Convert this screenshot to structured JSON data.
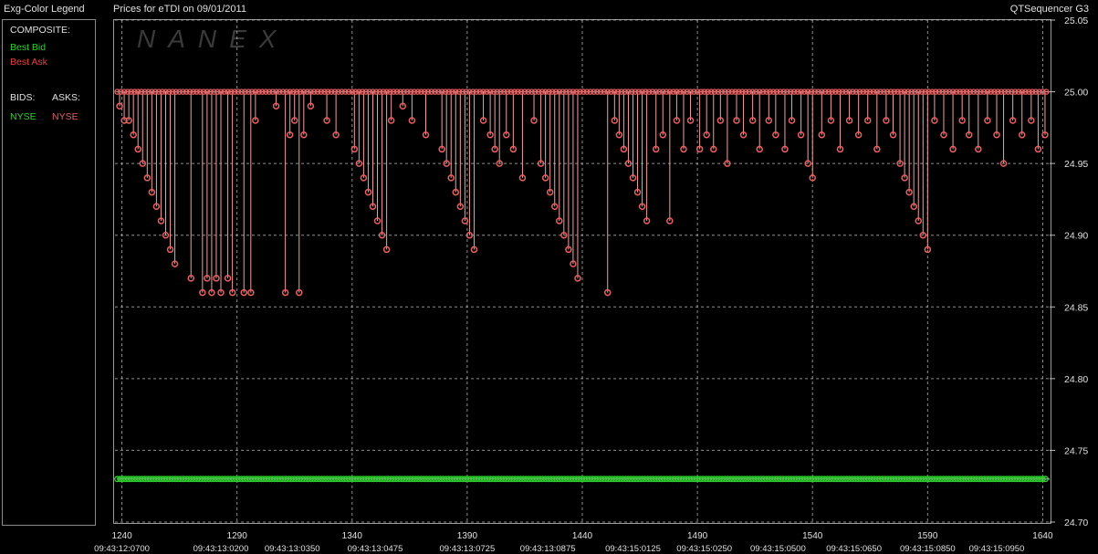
{
  "header": {
    "legend_title": "Exg-Color Legend",
    "chart_title": "Prices for  eTDI  on  09/01/2011",
    "app_name": "QTSequencer G3"
  },
  "legend": {
    "composite_label": "COMPOSITE:",
    "best_bid": "Best Bid",
    "best_ask": "Best Ask",
    "bids_label": "BIDS:",
    "asks_label": "ASKS:",
    "bid_exchange": "NYSE",
    "ask_exchange": "NYSE"
  },
  "watermark": "NANEX",
  "colors": {
    "bid": "#2ed12e",
    "ask": "#e86060",
    "ask_line": "#f0a0a0",
    "background": "#000000",
    "grid": "#bdbdbd"
  },
  "chart_data": {
    "type": "line",
    "title": "Prices for  eTDI  on  09/01/2011",
    "xlabel": "",
    "ylabel": "",
    "xlim": [
      1237,
      1643
    ],
    "ylim": [
      24.7,
      25.05
    ],
    "grid": true,
    "y_ticks": [
      "25.05",
      "25.00",
      "24.95",
      "24.90",
      "24.85",
      "24.80",
      "24.75",
      "24.70"
    ],
    "x_ticks": [
      1240,
      1290,
      1340,
      1390,
      1440,
      1490,
      1540,
      1590,
      1640
    ],
    "time_labels": [
      {
        "seq": 1240,
        "label": "09:43:12:0700"
      },
      {
        "seq": 1283,
        "label": "09:43:13:0200"
      },
      {
        "seq": 1314,
        "label": "09:43:13:0350"
      },
      {
        "seq": 1350,
        "label": "09:43:13:0475"
      },
      {
        "seq": 1390,
        "label": "09:43:13:0725"
      },
      {
        "seq": 1425,
        "label": "09:43:13:0875"
      },
      {
        "seq": 1462,
        "label": "09:43:15:0125"
      },
      {
        "seq": 1493,
        "label": "09:43:15:0250"
      },
      {
        "seq": 1525,
        "label": "09:43:15:0500"
      },
      {
        "seq": 1558,
        "label": "09:43:15:0650"
      },
      {
        "seq": 1590,
        "label": "09:43:15:0850"
      },
      {
        "seq": 1620,
        "label": "09:43:15:0950"
      }
    ],
    "series": [
      {
        "name": "NYSE Bid",
        "y": 24.73,
        "x_start": 1238,
        "x_end": 1642
      },
      {
        "name": "NYSE Ask",
        "y_level": 25.0,
        "dips": [
          {
            "x": 1239,
            "y": 24.99
          },
          {
            "x": 1241,
            "y": 24.98
          },
          {
            "x": 1243,
            "y": 24.98
          },
          {
            "x": 1245,
            "y": 24.97
          },
          {
            "x": 1247,
            "y": 24.96
          },
          {
            "x": 1249,
            "y": 24.95
          },
          {
            "x": 1251,
            "y": 24.94
          },
          {
            "x": 1253,
            "y": 24.93
          },
          {
            "x": 1255,
            "y": 24.92
          },
          {
            "x": 1257,
            "y": 24.91
          },
          {
            "x": 1259,
            "y": 24.9
          },
          {
            "x": 1261,
            "y": 24.89
          },
          {
            "x": 1263,
            "y": 24.88
          },
          {
            "x": 1270,
            "y": 24.87
          },
          {
            "x": 1275,
            "y": 24.86
          },
          {
            "x": 1277,
            "y": 24.87
          },
          {
            "x": 1279,
            "y": 24.86
          },
          {
            "x": 1281,
            "y": 24.87
          },
          {
            "x": 1283,
            "y": 24.86
          },
          {
            "x": 1286,
            "y": 24.87
          },
          {
            "x": 1288,
            "y": 24.86
          },
          {
            "x": 1293,
            "y": 24.86
          },
          {
            "x": 1296,
            "y": 24.86
          },
          {
            "x": 1298,
            "y": 24.98
          },
          {
            "x": 1307,
            "y": 24.99
          },
          {
            "x": 1311,
            "y": 24.86
          },
          {
            "x": 1313,
            "y": 24.97
          },
          {
            "x": 1315,
            "y": 24.98
          },
          {
            "x": 1317,
            "y": 24.86
          },
          {
            "x": 1319,
            "y": 24.97
          },
          {
            "x": 1322,
            "y": 24.99
          },
          {
            "x": 1329,
            "y": 24.98
          },
          {
            "x": 1333,
            "y": 24.97
          },
          {
            "x": 1341,
            "y": 24.96
          },
          {
            "x": 1343,
            "y": 24.95
          },
          {
            "x": 1345,
            "y": 24.94
          },
          {
            "x": 1347,
            "y": 24.93
          },
          {
            "x": 1349,
            "y": 24.92
          },
          {
            "x": 1351,
            "y": 24.91
          },
          {
            "x": 1353,
            "y": 24.9
          },
          {
            "x": 1355,
            "y": 24.89
          },
          {
            "x": 1357,
            "y": 24.98
          },
          {
            "x": 1362,
            "y": 24.99
          },
          {
            "x": 1366,
            "y": 24.98
          },
          {
            "x": 1372,
            "y": 24.97
          },
          {
            "x": 1379,
            "y": 24.96
          },
          {
            "x": 1381,
            "y": 24.95
          },
          {
            "x": 1383,
            "y": 24.94
          },
          {
            "x": 1385,
            "y": 24.93
          },
          {
            "x": 1387,
            "y": 24.92
          },
          {
            "x": 1389,
            "y": 24.91
          },
          {
            "x": 1391,
            "y": 24.9
          },
          {
            "x": 1393,
            "y": 24.89
          },
          {
            "x": 1397,
            "y": 24.98
          },
          {
            "x": 1400,
            "y": 24.97
          },
          {
            "x": 1402,
            "y": 24.96
          },
          {
            "x": 1404,
            "y": 24.95
          },
          {
            "x": 1407,
            "y": 24.97
          },
          {
            "x": 1410,
            "y": 24.96
          },
          {
            "x": 1414,
            "y": 24.94
          },
          {
            "x": 1419,
            "y": 24.98
          },
          {
            "x": 1422,
            "y": 24.95
          },
          {
            "x": 1424,
            "y": 24.94
          },
          {
            "x": 1426,
            "y": 24.93
          },
          {
            "x": 1428,
            "y": 24.92
          },
          {
            "x": 1430,
            "y": 24.91
          },
          {
            "x": 1432,
            "y": 24.9
          },
          {
            "x": 1434,
            "y": 24.89
          },
          {
            "x": 1436,
            "y": 24.88
          },
          {
            "x": 1438,
            "y": 24.87
          },
          {
            "x": 1451,
            "y": 24.86
          },
          {
            "x": 1454,
            "y": 24.98
          },
          {
            "x": 1456,
            "y": 24.97
          },
          {
            "x": 1458,
            "y": 24.96
          },
          {
            "x": 1460,
            "y": 24.95
          },
          {
            "x": 1462,
            "y": 24.94
          },
          {
            "x": 1464,
            "y": 24.93
          },
          {
            "x": 1466,
            "y": 24.92
          },
          {
            "x": 1468,
            "y": 24.91
          },
          {
            "x": 1472,
            "y": 24.96
          },
          {
            "x": 1475,
            "y": 24.97
          },
          {
            "x": 1478,
            "y": 24.91
          },
          {
            "x": 1481,
            "y": 24.98
          },
          {
            "x": 1484,
            "y": 24.96
          },
          {
            "x": 1487,
            "y": 24.98
          },
          {
            "x": 1491,
            "y": 24.96
          },
          {
            "x": 1494,
            "y": 24.97
          },
          {
            "x": 1497,
            "y": 24.96
          },
          {
            "x": 1500,
            "y": 24.98
          },
          {
            "x": 1503,
            "y": 24.95
          },
          {
            "x": 1507,
            "y": 24.98
          },
          {
            "x": 1510,
            "y": 24.97
          },
          {
            "x": 1514,
            "y": 24.98
          },
          {
            "x": 1517,
            "y": 24.96
          },
          {
            "x": 1521,
            "y": 24.98
          },
          {
            "x": 1524,
            "y": 24.97
          },
          {
            "x": 1528,
            "y": 24.96
          },
          {
            "x": 1531,
            "y": 24.98
          },
          {
            "x": 1535,
            "y": 24.97
          },
          {
            "x": 1538,
            "y": 24.95
          },
          {
            "x": 1540,
            "y": 24.94
          },
          {
            "x": 1544,
            "y": 24.97
          },
          {
            "x": 1548,
            "y": 24.98
          },
          {
            "x": 1552,
            "y": 24.96
          },
          {
            "x": 1556,
            "y": 24.98
          },
          {
            "x": 1560,
            "y": 24.97
          },
          {
            "x": 1564,
            "y": 24.98
          },
          {
            "x": 1568,
            "y": 24.96
          },
          {
            "x": 1572,
            "y": 24.98
          },
          {
            "x": 1575,
            "y": 24.97
          },
          {
            "x": 1578,
            "y": 24.95
          },
          {
            "x": 1580,
            "y": 24.94
          },
          {
            "x": 1582,
            "y": 24.93
          },
          {
            "x": 1584,
            "y": 24.92
          },
          {
            "x": 1586,
            "y": 24.91
          },
          {
            "x": 1588,
            "y": 24.9
          },
          {
            "x": 1590,
            "y": 24.89
          },
          {
            "x": 1593,
            "y": 24.98
          },
          {
            "x": 1597,
            "y": 24.97
          },
          {
            "x": 1601,
            "y": 24.96
          },
          {
            "x": 1605,
            "y": 24.98
          },
          {
            "x": 1608,
            "y": 24.97
          },
          {
            "x": 1612,
            "y": 24.96
          },
          {
            "x": 1616,
            "y": 24.98
          },
          {
            "x": 1620,
            "y": 24.97
          },
          {
            "x": 1623,
            "y": 24.95
          },
          {
            "x": 1627,
            "y": 24.98
          },
          {
            "x": 1631,
            "y": 24.97
          },
          {
            "x": 1635,
            "y": 24.98
          },
          {
            "x": 1638,
            "y": 24.96
          },
          {
            "x": 1641,
            "y": 24.97
          }
        ]
      }
    ]
  }
}
